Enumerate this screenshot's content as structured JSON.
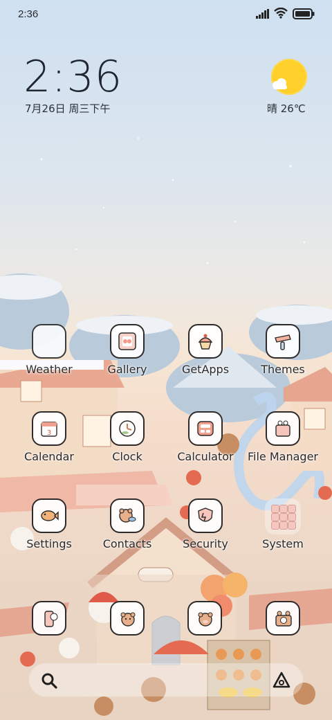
{
  "status_bar": {
    "time": "2:36"
  },
  "clock_widget": {
    "time": "2:36",
    "date": "7月26日 周三下午"
  },
  "weather_widget": {
    "text": "晴 26℃"
  },
  "apps": [
    {
      "label": "Weather",
      "icon": "weather-icon"
    },
    {
      "label": "Gallery",
      "icon": "gallery-icon"
    },
    {
      "label": "GetApps",
      "icon": "getapps-icon"
    },
    {
      "label": "Themes",
      "icon": "themes-icon"
    },
    {
      "label": "Calendar",
      "icon": "calendar-icon"
    },
    {
      "label": "Clock",
      "icon": "clock-icon"
    },
    {
      "label": "Calculator",
      "icon": "calculator-icon"
    },
    {
      "label": "File Manager",
      "icon": "file-manager-icon"
    },
    {
      "label": "Settings",
      "icon": "settings-icon"
    },
    {
      "label": "Contacts",
      "icon": "contacts-icon"
    },
    {
      "label": "Security",
      "icon": "security-icon"
    },
    {
      "label": "System",
      "icon": "folder-icon"
    }
  ],
  "calendar_day": "3",
  "colors": {
    "accent": "#ffcf2b",
    "outline": "#2e2a2a",
    "pink": "#f2b7ac",
    "peach": "#f6dcc5"
  }
}
